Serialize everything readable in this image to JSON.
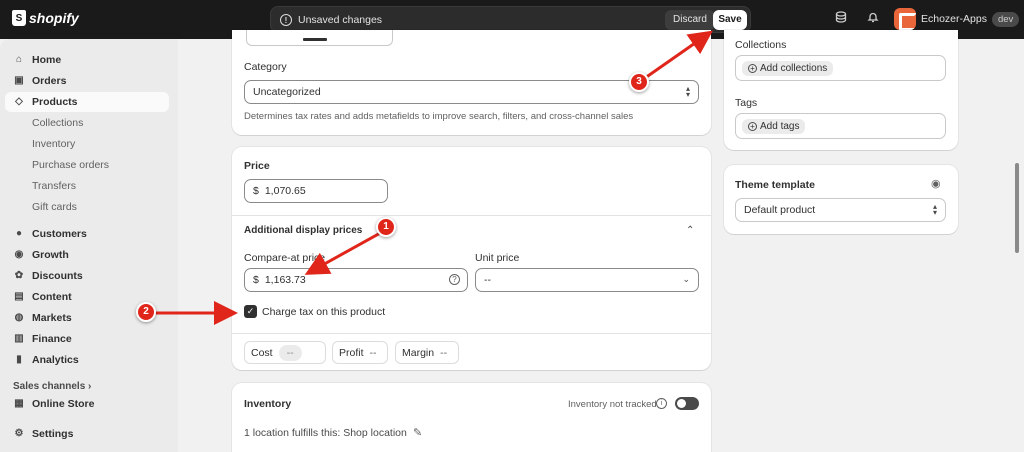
{
  "topbar": {
    "brand": "shopify",
    "unsaved_message": "Unsaved changes",
    "discard_label": "Discard",
    "save_label": "Save",
    "store_name": "Echozer-Apps",
    "store_badge": "dev"
  },
  "sidebar": {
    "items": [
      {
        "label": "Home",
        "icon": "home-icon"
      },
      {
        "label": "Orders",
        "icon": "orders-icon"
      },
      {
        "label": "Products",
        "icon": "tag-icon"
      },
      {
        "label": "Customers",
        "icon": "person-icon"
      },
      {
        "label": "Growth",
        "icon": "growth-icon"
      },
      {
        "label": "Discounts",
        "icon": "discount-icon"
      },
      {
        "label": "Content",
        "icon": "content-icon"
      },
      {
        "label": "Markets",
        "icon": "globe-icon"
      },
      {
        "label": "Finance",
        "icon": "bank-icon"
      },
      {
        "label": "Analytics",
        "icon": "chart-icon"
      }
    ],
    "product_sub": [
      "Collections",
      "Inventory",
      "Purchase orders",
      "Transfers",
      "Gift cards"
    ],
    "sales_channels": "Sales channels",
    "online_store": "Online Store",
    "settings": "Settings"
  },
  "category": {
    "label": "Category",
    "value": "Uncategorized",
    "hint": "Determines tax rates and adds metafields to improve search, filters, and cross-channel sales"
  },
  "price": {
    "title": "Price",
    "currency": "$",
    "price_value": "1,070.65",
    "additional_title": "Additional display prices",
    "compare_label": "Compare-at price",
    "compare_value": "1,163.73",
    "unit_label": "Unit price",
    "unit_value": "--",
    "charge_tax_label": "Charge tax on this product",
    "charge_tax_checked": true,
    "cost_label": "Cost",
    "cost_value": "--",
    "profit_label": "Profit",
    "profit_value": "--",
    "margin_label": "Margin",
    "margin_value": "--"
  },
  "inventory": {
    "title": "Inventory",
    "tracking_label": "Inventory not tracked",
    "location_text": "1 location fulfills this: Shop location"
  },
  "organization": {
    "collections_label": "Collections",
    "add_collections": "Add collections",
    "tags_label": "Tags",
    "add_tags": "Add tags"
  },
  "theme": {
    "title": "Theme template",
    "value": "Default product"
  },
  "annotations": [
    "1",
    "2",
    "3"
  ],
  "colors": {
    "accent_red": "#e0261b",
    "topbar": "#1a1a1a"
  }
}
